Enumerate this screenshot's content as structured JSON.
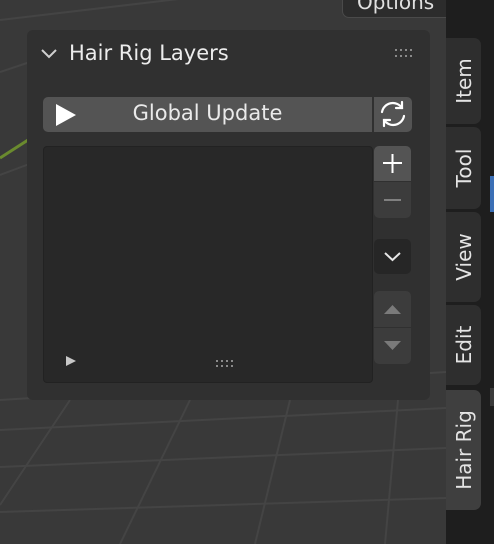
{
  "header": {
    "options_label": "Options"
  },
  "panel": {
    "title": "Hair Rig Layers",
    "global_update_label": "Global Update"
  },
  "sidebar": {
    "tabs": [
      {
        "label": "Item",
        "active": false
      },
      {
        "label": "Tool",
        "active": false
      },
      {
        "label": "View",
        "active": false
      },
      {
        "label": "Edit",
        "active": false
      },
      {
        "label": "Hair Rig",
        "active": true
      }
    ]
  },
  "icons": {
    "collapse": "chevron-down-icon",
    "grip": "drag-grip-icon",
    "play": "play-icon",
    "refresh": "refresh-icon",
    "add": "plus-icon",
    "remove": "minus-icon",
    "specials": "chevron-down-icon",
    "up": "triangle-up-icon",
    "down": "triangle-down-icon",
    "filter": "triangle-right-icon",
    "resize": "resize-grip-icon"
  },
  "colors": {
    "viewport_bg": "#393939",
    "panel_bg": "#303030",
    "button_bg": "#545454",
    "sidebar_bg": "#1e1e1e",
    "accent": "#3b6fb6",
    "axis_green": "#6a8a2e"
  }
}
